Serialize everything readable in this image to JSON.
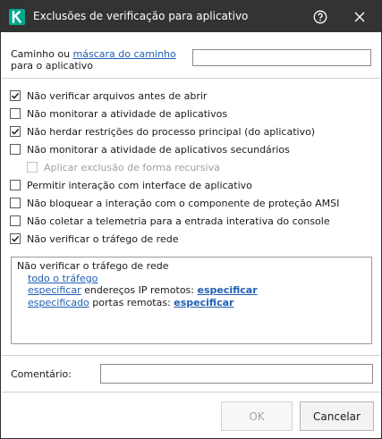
{
  "window": {
    "title": "Exclusões de verificação para aplicativo",
    "icons": {
      "logo": "kaspersky-k-logo",
      "help": "help-icon",
      "close": "close-icon"
    },
    "colors": {
      "titlebar": "#333333",
      "logo": "#00a88e",
      "link": "#1f5fb2"
    }
  },
  "path": {
    "label_prefix": "Caminho ou ",
    "label_link": "máscara do caminho",
    "label_suffix": " para o aplicativo",
    "value": ""
  },
  "options": [
    {
      "label": "Não verificar arquivos antes de abrir",
      "checked": true,
      "disabled": false
    },
    {
      "label": "Não monitorar a atividade de aplicativos",
      "checked": false,
      "disabled": false
    },
    {
      "label": "Não herdar restrições do processo principal (do aplicativo)",
      "checked": true,
      "disabled": false
    },
    {
      "label": "Não monitorar a atividade de aplicativos secundários",
      "checked": false,
      "disabled": false
    },
    {
      "label": "Aplicar exclusão de forma recursiva",
      "checked": false,
      "disabled": true
    },
    {
      "label": "Permitir interação com interface de aplicativo",
      "checked": false,
      "disabled": false
    },
    {
      "label": "Não bloquear a interação com o componente de proteção AMSI",
      "checked": false,
      "disabled": false
    },
    {
      "label": "Não coletar a telemetria para a entrada interativa do console",
      "checked": false,
      "disabled": false
    },
    {
      "label": "Não verificar o tráfego de rede",
      "checked": true,
      "disabled": false
    }
  ],
  "summary": {
    "heading": "Não verificar o tráfego de rede",
    "traffic_link": "todo o tráfego",
    "ip_link": "especificar",
    "ip_text": " endereços IP remotos: ",
    "ip_value_link": "especificar",
    "ports_link": "especificado",
    "ports_text": " portas remotas: ",
    "ports_value_link": "especificar"
  },
  "comment": {
    "label": "Comentário:",
    "value": ""
  },
  "buttons": {
    "ok": "OK",
    "cancel": "Cancelar",
    "ok_disabled": true
  }
}
